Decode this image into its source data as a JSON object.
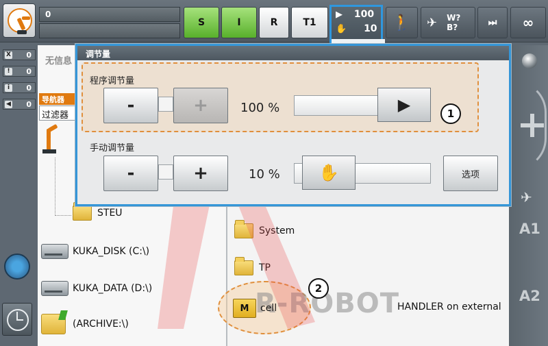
{
  "topbar": {
    "message_value": "0",
    "message_value2": "",
    "mode_buttons": [
      {
        "label": "S",
        "color": "#5ab02d"
      },
      {
        "label": "I",
        "color": "#5ab02d"
      },
      {
        "label": "R",
        "color": "#ffffff"
      },
      {
        "label": "T1",
        "color": "#ffffff"
      }
    ],
    "override": {
      "program": "100",
      "jog": "10"
    },
    "tool_status": "W?\nB?",
    "tool_w": "W?",
    "tool_b": "B?",
    "increment_label": "∞",
    "accent_color": "#2f97de"
  },
  "status_counters": [
    {
      "icon": "X",
      "value": "0"
    },
    {
      "icon": "!",
      "value": "0"
    },
    {
      "icon": "i",
      "value": "0"
    },
    {
      "icon": "◀",
      "value": "0"
    }
  ],
  "navigator": {
    "title": "无信息",
    "tab_label": "导航器",
    "filter_label": "过滤器",
    "tree_items": [
      {
        "label": "STEU"
      }
    ],
    "drives": [
      {
        "label": "KUKA_DISK (C:\\)"
      },
      {
        "label": "KUKA_DATA (D:\\)"
      },
      {
        "label": "(ARCHIVE:\\)"
      }
    ],
    "files": [
      {
        "label": "System"
      },
      {
        "label": "TP"
      },
      {
        "label": "cell",
        "comment": "HANDLER on external"
      }
    ]
  },
  "right_column": {
    "a1": "A1",
    "a2": "A2"
  },
  "dialog": {
    "title": "调节量",
    "program_override": {
      "label": "程序调节量",
      "minus": "-",
      "plus": "+",
      "value": "100 %",
      "level": 1.0
    },
    "manual_override": {
      "label": "手动调节量",
      "minus": "-",
      "plus": "+",
      "value": "10 %",
      "level": 0.1
    },
    "options_label": "选项",
    "highlight_color": "#e08f3c"
  },
  "callouts": [
    "1",
    "2"
  ],
  "watermark": "R-ROBOT"
}
